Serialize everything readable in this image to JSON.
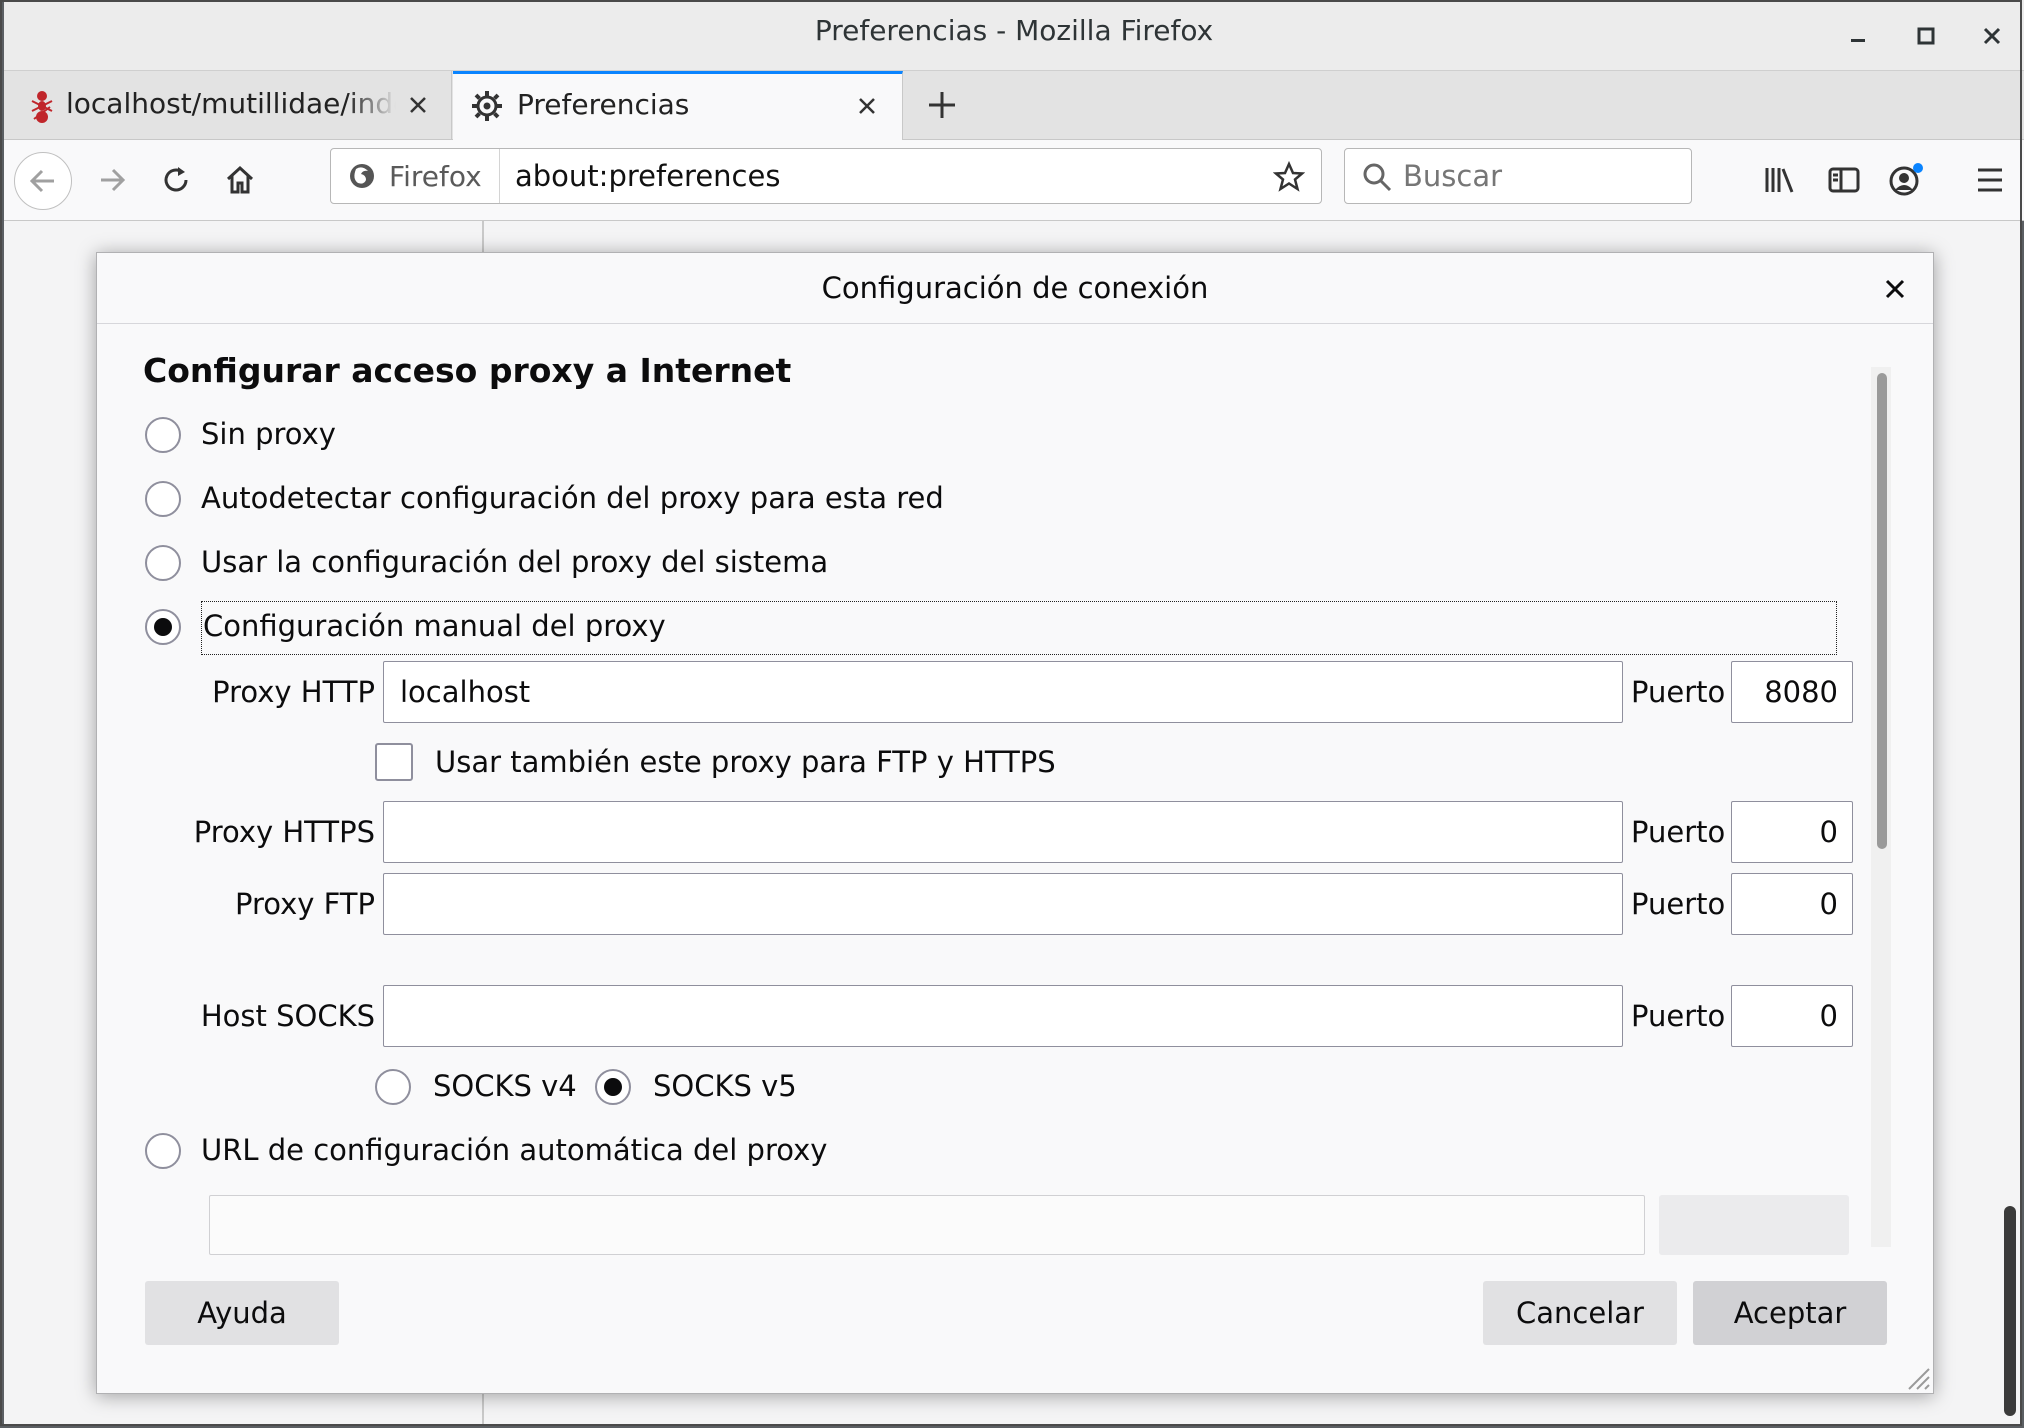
{
  "window": {
    "title": "Preferencias - Mozilla Firefox"
  },
  "tabs": [
    {
      "label": "localhost/mutillidae/index",
      "icon": "ant-favicon-icon"
    },
    {
      "label": "Preferencias",
      "icon": "gear-icon"
    }
  ],
  "navbar": {
    "identity_label": "Firefox",
    "url": "about:preferences",
    "search_placeholder": "Buscar"
  },
  "dialog": {
    "title": "Configuración de conexión",
    "heading": "Configurar acceso proxy a Internet",
    "options": {
      "no_proxy": "Sin proxy",
      "autodetect": "Autodetectar configuración del proxy para esta red",
      "system": "Usar la configuración del proxy del sistema",
      "manual": "Configuración manual del proxy",
      "pac_url": "URL de configuración automática del proxy"
    },
    "selected_option": "manual",
    "http": {
      "label": "Proxy HTTP",
      "value": "localhost",
      "port_label": "Puerto",
      "port": "8080"
    },
    "share_checkbox": {
      "label": "Usar también este proxy para FTP y HTTPS",
      "checked": false
    },
    "https": {
      "label": "Proxy HTTPS",
      "value": "",
      "port_label": "Puerto",
      "port": "0"
    },
    "ftp": {
      "label": "Proxy FTP",
      "value": "",
      "port_label": "Puerto",
      "port": "0"
    },
    "socks": {
      "label": "Host SOCKS",
      "value": "",
      "port_label": "Puerto",
      "port": "0",
      "v4_label": "SOCKS v4",
      "v5_label": "SOCKS v5",
      "selected_version": "v5"
    },
    "buttons": {
      "help": "Ayuda",
      "cancel": "Cancelar",
      "accept": "Aceptar"
    }
  },
  "colors": {
    "accent": "#0a84ff",
    "dialog_bg": "#f9f9fa",
    "button_bg": "#e1e1e3"
  }
}
